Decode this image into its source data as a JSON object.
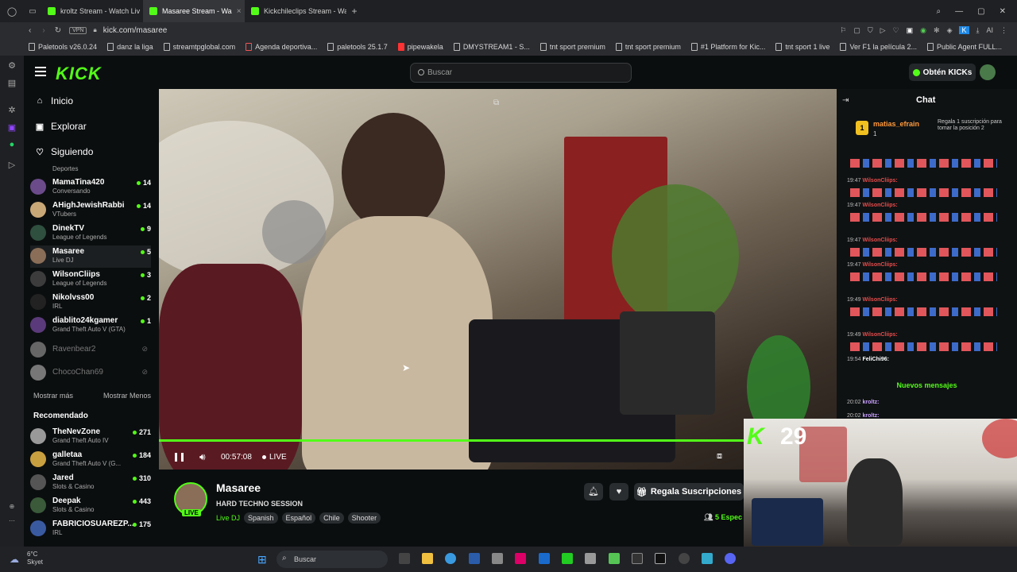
{
  "browser": {
    "tabs": [
      {
        "label": "kroltz Stream - Watch Liv"
      },
      {
        "label": "Masaree Stream - Wa"
      },
      {
        "label": "Kickchileclips Stream - Wa"
      }
    ],
    "vpn_label": "VPN",
    "url": "kick.com/masaree",
    "ai_label": "AI",
    "bookmarks": [
      "Paletools v26.0.24",
      "danz la liga",
      "streamtpglobal.com",
      "Agenda deportiva...",
      "paletools 25.1.7",
      "pipewakela",
      "DMYSTREAM1 - S...",
      "tnt sport premium",
      "tnt sport premium",
      "#1 Platform for Kic...",
      "tnt sport 1 live",
      "Ver F1 la película 2...",
      "Public Agent FULL..."
    ]
  },
  "header": {
    "logo": "KICK",
    "search_placeholder": "Buscar",
    "kicks_button": "Obtén KICKs"
  },
  "sidebar": {
    "nav": [
      {
        "label": "Inicio"
      },
      {
        "label": "Explorar"
      },
      {
        "label": "Siguiendo"
      }
    ],
    "category_hint": "Deportes",
    "following": [
      {
        "name": "MamaTina420",
        "category": "Conversando",
        "viewers": "14"
      },
      {
        "name": "AHighJewishRabbi",
        "category": "VTubers",
        "viewers": "14"
      },
      {
        "name": "DinekTV",
        "category": "League of Legends",
        "viewers": "9"
      },
      {
        "name": "Masaree",
        "category": "Live DJ",
        "viewers": "5"
      },
      {
        "name": "WilsonCliips",
        "category": "League of Legends",
        "viewers": "3"
      },
      {
        "name": "Nikolvss00",
        "category": "IRL",
        "viewers": "2"
      },
      {
        "name": "diablito24kgamer",
        "category": "Grand Theft Auto V (GTA)",
        "viewers": "1"
      },
      {
        "name": "Ravenbear2",
        "category": "",
        "viewers": ""
      },
      {
        "name": "ChocoChan69",
        "category": "",
        "viewers": ""
      }
    ],
    "show_more": "Mostrar más",
    "show_less": "Mostrar Menos",
    "recommended_title": "Recomendado",
    "recommended": [
      {
        "name": "TheNevZone",
        "category": "Grand Theft Auto IV",
        "viewers": "271"
      },
      {
        "name": "galletaa",
        "category": "Grand Theft Auto V (G...",
        "viewers": "184"
      },
      {
        "name": "Jared",
        "category": "Slots & Casino",
        "viewers": "310"
      },
      {
        "name": "Deepak",
        "category": "Slots & Casino",
        "viewers": "443"
      },
      {
        "name": "FABRICIOSUAREZP...",
        "category": "IRL",
        "viewers": "175"
      }
    ]
  },
  "player": {
    "time": "00:57:08",
    "live_label": "LIVE",
    "progress_fraction": 0.87
  },
  "stream": {
    "name": "Masaree",
    "title": "HARD TECHNO SESSION",
    "live_badge": "LIVE",
    "category": "Live DJ",
    "tags": [
      "Spanish",
      "Español",
      "Chile",
      "Shooter"
    ],
    "gift_button": "Regala Suscripciones",
    "viewers": "5 Espec"
  },
  "chat": {
    "title": "Chat",
    "pinned": {
      "rank": "1",
      "user": "matias_efrain",
      "count": "1",
      "note": "Regala 1 suscripción para tomar la posición 2"
    },
    "messages": [
      {
        "time": "19:47",
        "user": "WilsonCliips:"
      },
      {
        "time": "19:47",
        "user": "WilsonCliips:"
      },
      {
        "time": "19:47",
        "user": "WilsonCliips:"
      },
      {
        "time": "19:47",
        "user": "WilsonCliips:"
      },
      {
        "time": "19:49",
        "user": "WilsonCliips:"
      },
      {
        "time": "19:49",
        "user": "WilsonCliips:"
      },
      {
        "time": "19:54",
        "user": "FeliChi96:"
      }
    ],
    "new_messages": "Nuevos mensajes",
    "recent": [
      {
        "time": "20:02",
        "user": "kroltz:"
      },
      {
        "time": "20:02",
        "user": "kroltz:"
      }
    ]
  },
  "overlay": {
    "number": "29"
  },
  "taskbar": {
    "temperature": "6°C",
    "weather": "Skyet",
    "search": "Buscar"
  }
}
